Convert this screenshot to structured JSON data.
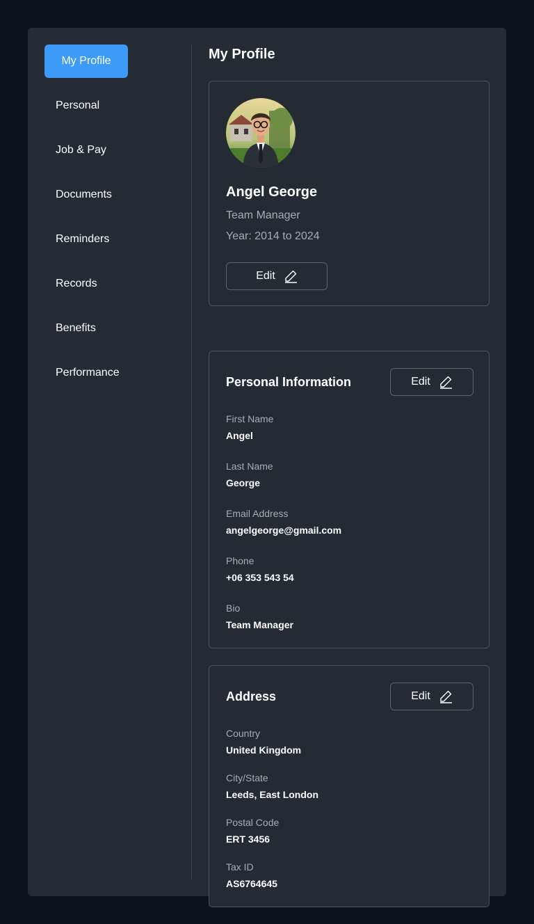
{
  "sidebar": {
    "items": [
      {
        "label": "My Profile",
        "active": true
      },
      {
        "label": "Personal"
      },
      {
        "label": "Job & Pay"
      },
      {
        "label": "Documents"
      },
      {
        "label": "Reminders"
      },
      {
        "label": "Records"
      },
      {
        "label": "Benefits"
      },
      {
        "label": "Performance"
      }
    ]
  },
  "main": {
    "title": "My Profile",
    "profile": {
      "avatar_icon": "avatar-person-in-suit",
      "name": "Angel George",
      "role": "Team Manager",
      "years": "Year: 2014 to 2024",
      "edit_label": "Edit"
    },
    "personal": {
      "title": "Personal Information",
      "edit_label": "Edit",
      "fields": [
        {
          "label": "First Name",
          "value": "Angel"
        },
        {
          "label": "Last Name",
          "value": "George"
        },
        {
          "label": "Email Address",
          "value": "angelgeorge@gmail.com"
        },
        {
          "label": "Phone",
          "value": "+06 353 543 54"
        },
        {
          "label": "Bio",
          "value": "Team Manager"
        }
      ]
    },
    "address": {
      "title": "Address",
      "edit_label": "Edit",
      "fields": [
        {
          "label": "Country",
          "value": "United Kingdom"
        },
        {
          "label": "City/State",
          "value": "Leeds, East London"
        },
        {
          "label": "Postal Code",
          "value": "ERT 3456"
        },
        {
          "label": "Tax ID",
          "value": "AS6764645"
        }
      ]
    }
  },
  "colors": {
    "background": "#0e131b",
    "panel": "#252b32",
    "accent": "#3d9bf5",
    "border": "#4a525b",
    "muted_text": "#a6adb5"
  }
}
